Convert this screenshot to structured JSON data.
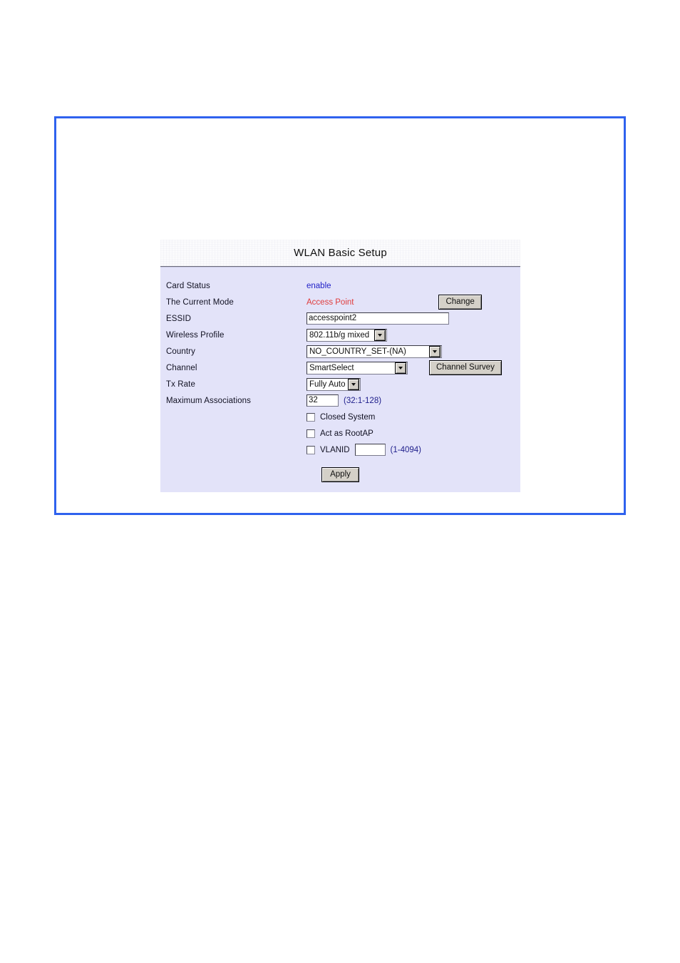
{
  "panel": {
    "title": "WLAN Basic Setup",
    "rows": {
      "card_status": {
        "label": "Card Status",
        "value": "enable"
      },
      "current_mode": {
        "label": "The Current Mode",
        "value": "Access Point",
        "button": "Change"
      },
      "essid": {
        "label": "ESSID",
        "value": "accesspoint2"
      },
      "wireless_profile": {
        "label": "Wireless Profile",
        "value": "802.11b/g mixed"
      },
      "country": {
        "label": "Country",
        "value": "NO_COUNTRY_SET-(NA)"
      },
      "channel": {
        "label": "Channel",
        "value": "SmartSelect",
        "button": "Channel Survey"
      },
      "tx_rate": {
        "label": "Tx Rate",
        "value": "Fully Auto"
      },
      "max_associations": {
        "label": "Maximum Associations",
        "value": "32",
        "hint": "(32:1-128)"
      },
      "closed_system": {
        "label": "Closed System",
        "checked": false
      },
      "act_as_rootap": {
        "label": "Act as RootAP",
        "checked": false
      },
      "vlanid": {
        "label": "VLANID",
        "value": "",
        "hint": "(1-4094)",
        "checked": false
      }
    },
    "apply_button": "Apply"
  },
  "colors": {
    "frame_blue": "#2f62ee",
    "body_lavender": "#e3e3f9",
    "status_blue": "#2222c8",
    "mode_red": "#e03c3c",
    "hint_navy": "#20208c"
  }
}
